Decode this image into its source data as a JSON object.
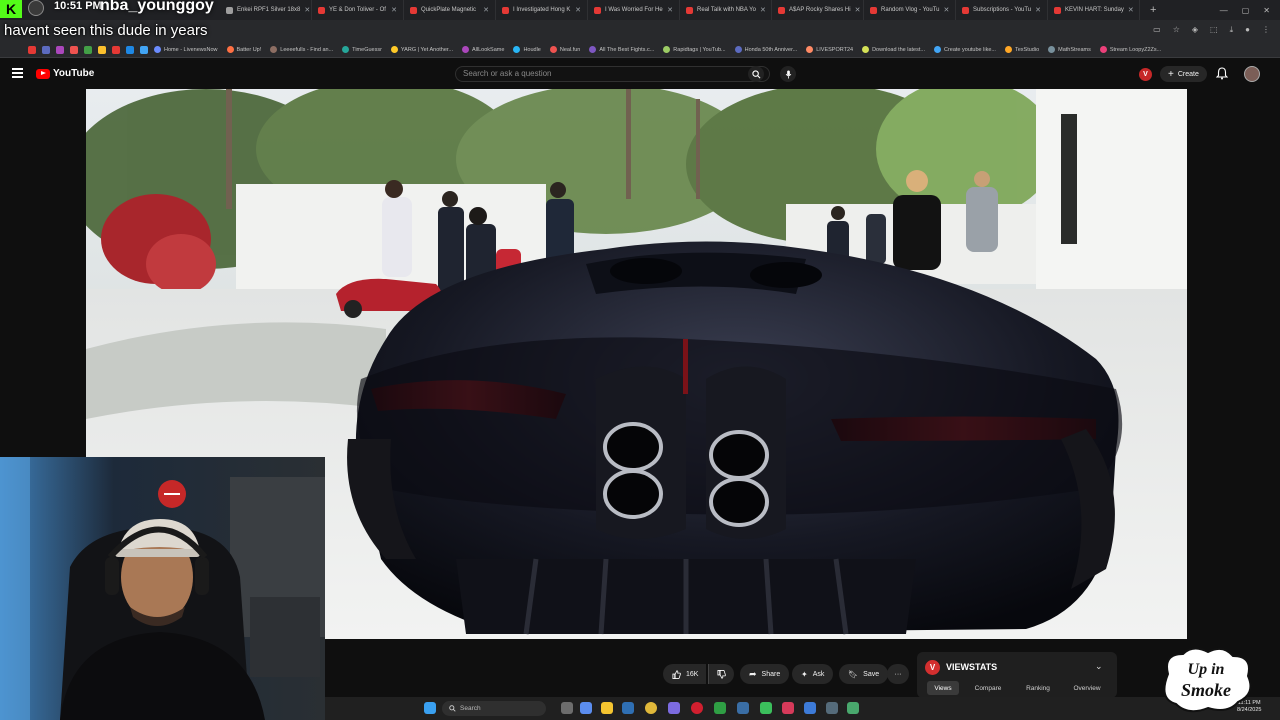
{
  "overlay": {
    "time": "10:51 PM",
    "username": "nba_younggoy",
    "chat_message": "havent seen this dude in years",
    "platform_badge": "K"
  },
  "tabs": [
    {
      "label": "Enkei RPF1 Silver 18x8",
      "color": "#9e9e9e"
    },
    {
      "label": "YE & Don Toliver - Of",
      "color": "#e53935"
    },
    {
      "label": "QuickPlate Magnetic",
      "color": "#e53935"
    },
    {
      "label": "I Investigated Hong K",
      "color": "#e53935"
    },
    {
      "label": "I Was Worried For He",
      "color": "#e53935"
    },
    {
      "label": "Real Talk with NBA Yo",
      "color": "#e53935"
    },
    {
      "label": "A$AP Rocky Shares Hi",
      "color": "#e53935"
    },
    {
      "label": "Random Vlog - YouTu",
      "color": "#e53935"
    },
    {
      "label": "Subscriptions - YouTu",
      "color": "#e53935"
    },
    {
      "label": "KEVIN HART: Sunday",
      "color": "#e53935"
    }
  ],
  "bookmarks": [
    "Home - LivenewsNow",
    "Batter Up!",
    "Leeeefulls - Find an...",
    "TimeGuessr",
    "YARG | Yet Another...",
    "AllLookSame",
    "Houdle",
    "Neal.fun",
    "All The Best Fights.c...",
    "Rapidtags | YouTub...",
    "Honda 50th Anniver...",
    "LIVESPORT24",
    "Download the latest...",
    "Create youtube like...",
    "TexStudio",
    "MathStreams",
    "Stream LoopyZ2Zs..."
  ],
  "youtube": {
    "logo_text": "YouTube",
    "search_placeholder": "Search or ask a question",
    "create_label": "Create",
    "channel_letter": "V"
  },
  "actions": {
    "likes": "16K",
    "share": "Share",
    "ask": "Ask",
    "save": "Save",
    "more": "···"
  },
  "viewstats": {
    "title": "VIEWSTATS",
    "tabs": [
      "Views",
      "Compare",
      "Ranking",
      "Overview"
    ],
    "active_tab": "Views"
  },
  "taskbar": {
    "search_placeholder": "Search",
    "clock_time": "11:11 PM",
    "clock_date": "8/24/2025"
  },
  "watermark": {
    "text": "Up in Smoke"
  }
}
